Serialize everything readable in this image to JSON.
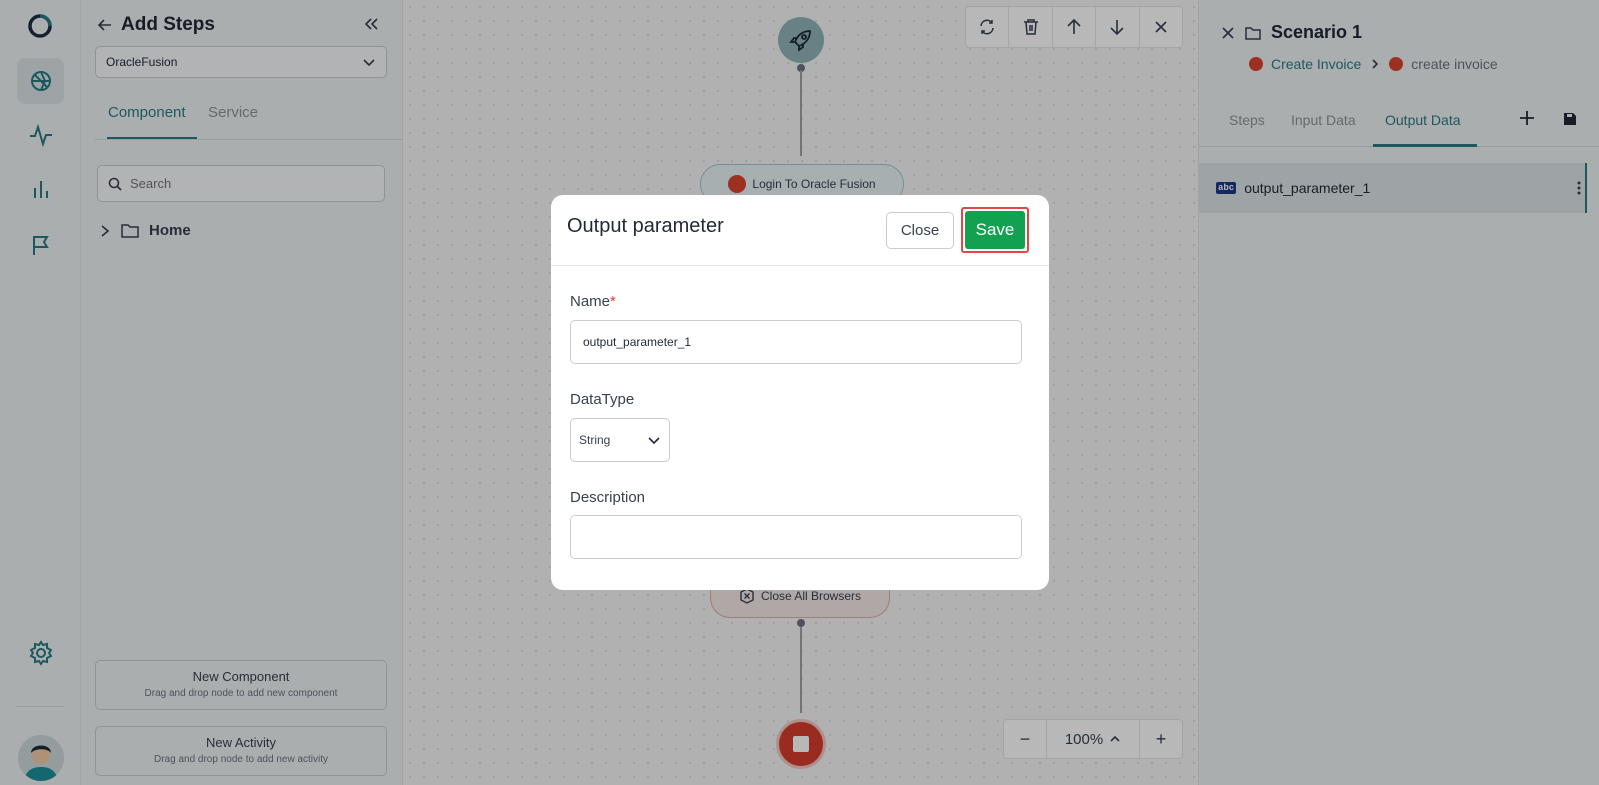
{
  "left_panel": {
    "title": "Add Steps",
    "app_select": "OracleFusion",
    "tabs": [
      "Component",
      "Service"
    ],
    "search_placeholder": "Search",
    "tree_root": "Home",
    "new_component": {
      "title": "New Component",
      "hint": "Drag and drop node to add new component"
    },
    "new_activity": {
      "title": "New Activity",
      "hint": "Drag and drop node to add new activity"
    }
  },
  "canvas": {
    "nodes": {
      "login": "Login To Oracle Fusion",
      "close_browsers": "Close All Browsers"
    },
    "zoom": "100%"
  },
  "right_panel": {
    "title": "Scenario 1",
    "breadcrumb": {
      "parent": "Create Invoice",
      "current": "create invoice"
    },
    "tabs": [
      "Steps",
      "Input Data",
      "Output Data"
    ],
    "output_items": [
      "output_parameter_1"
    ]
  },
  "modal": {
    "title": "Output parameter",
    "close_label": "Close",
    "save_label": "Save",
    "name_label": "Name",
    "name_required": "*",
    "name_value": "output_parameter_1",
    "datatype_label": "DataType",
    "datatype_value": "String",
    "description_label": "Description",
    "description_value": ""
  },
  "colors": {
    "accent": "#2a7a84",
    "save": "#12a150",
    "highlight": "#e04848",
    "stop": "#d53c2e"
  },
  "icons": [
    "logo-icon",
    "network-icon",
    "pulse-icon",
    "bar-chart-icon",
    "flag-icon",
    "settings-icon",
    "back-arrow-icon",
    "collapse-icon",
    "chevron-down-icon",
    "search-icon",
    "chevron-right-icon",
    "folder-icon",
    "refresh-icon",
    "trash-icon",
    "arrow-up-icon",
    "arrow-down-icon",
    "close-icon",
    "rocket-icon",
    "stop-icon",
    "plus-icon",
    "save-icon",
    "more-icon"
  ]
}
